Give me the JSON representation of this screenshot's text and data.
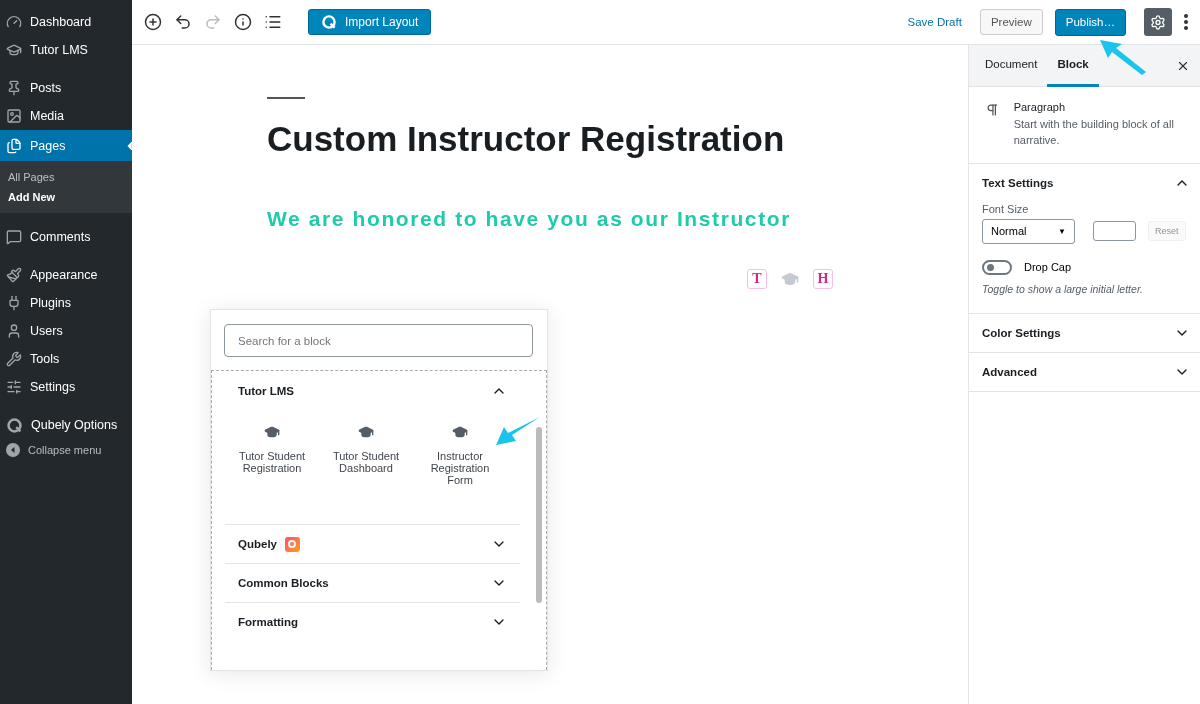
{
  "admin_menu": {
    "items": [
      {
        "label": "Dashboard",
        "selected": false
      },
      {
        "label": "Tutor LMS",
        "selected": false
      },
      {
        "label": "Posts",
        "selected": false
      },
      {
        "label": "Media",
        "selected": false
      },
      {
        "label": "Pages",
        "selected": true,
        "submenu": [
          {
            "label": "All Pages",
            "selected": false
          },
          {
            "label": "Add New",
            "selected": true
          }
        ]
      },
      {
        "label": "Comments",
        "selected": false
      },
      {
        "label": "Appearance",
        "selected": false
      },
      {
        "label": "Plugins",
        "selected": false
      },
      {
        "label": "Users",
        "selected": false
      },
      {
        "label": "Tools",
        "selected": false
      },
      {
        "label": "Settings",
        "selected": false
      },
      {
        "label": "Qubely Options",
        "selected": false
      }
    ],
    "collapse": "Collapse menu"
  },
  "toolbar": {
    "import_button": "Import Layout",
    "save_draft": "Save Draft",
    "preview": "Preview",
    "publish": "Publish…",
    "settings_active": true
  },
  "editor": {
    "title": "Custom Instructor Registration",
    "subtitle": "We are honored to have you as our Instructor",
    "block_icons": [
      {
        "kind": "letter",
        "text": "T"
      },
      {
        "kind": "cap"
      },
      {
        "kind": "letter",
        "text": "H"
      }
    ]
  },
  "inserter": {
    "search_placeholder": "Search for a block",
    "categories": [
      {
        "name": "Tutor LMS",
        "expanded": true,
        "blocks": [
          "Tutor Student Registration",
          "Tutor Student Dashboard",
          "Instructor Registration Form"
        ]
      },
      {
        "name": "Qubely",
        "expanded": false
      },
      {
        "name": "Common Blocks",
        "expanded": false
      },
      {
        "name": "Formatting",
        "expanded": false
      }
    ]
  },
  "settings_sidebar": {
    "tabs": [
      {
        "label": "Document",
        "selected": false
      },
      {
        "label": "Block",
        "selected": true
      }
    ],
    "block_name": "Paragraph",
    "block_description": "Start with the building block of all narrative.",
    "panels": [
      {
        "title": "Text Settings",
        "expanded": true
      },
      {
        "title": "Color Settings",
        "expanded": false
      },
      {
        "title": "Advanced",
        "expanded": false
      }
    ],
    "font_size_label": "Font Size",
    "font_size_value": "Normal",
    "select_caret": "▼",
    "reset": "Reset",
    "drop_cap": {
      "label": "Drop Cap",
      "on": false,
      "help": "Toggle to show a large initial letter."
    }
  }
}
